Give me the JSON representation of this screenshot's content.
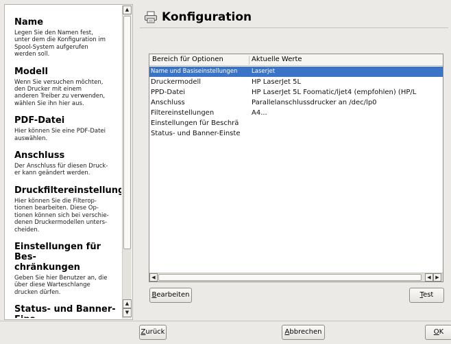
{
  "help": {
    "sections": [
      {
        "heading": "Name",
        "text": "Legen Sie den Namen fest,\nunter dem die Konfiguration im\nSpool-System aufgerufen\nwerden soll."
      },
      {
        "heading": "Modell",
        "text": "Wenn Sie versuchen möchten,\nden Drucker mit einem\nanderen Treiber zu verwenden,\nwählen Sie ihn hier aus."
      },
      {
        "heading": "PDF-Datei",
        "text": "Hier können Sie eine PDF-Datei\nauswählen."
      },
      {
        "heading": "Anschluss",
        "text": "Der Anschluss für diesen Druck-\ner kann geändert werden."
      },
      {
        "heading": "Druckfiltereinstellungen",
        "text": "Hier können Sie die Filterop-\ntionen bearbeiten. Diese Op-\ntionen können sich bei verschie-\ndenen Druckermodellen unters-\ncheiden."
      },
      {
        "heading": "Einstellungen für Bes-\nchränkungen",
        "text": "Geben Sie hier Benutzer an, die\nüber diese Warteschlange\ndrucken dürfen."
      },
      {
        "heading": "Status- und Banner-Eins-",
        "text": ""
      }
    ],
    "scroll_up_icon": "triangle-up",
    "scroll_down_icon": "triangle-down"
  },
  "header": {
    "title": "Konfiguration",
    "icon": "printer-icon"
  },
  "table": {
    "columns": [
      "Bereich für Optionen",
      "Aktuelle Werte"
    ],
    "rows": [
      {
        "area": "Name und Basiseinstellungen",
        "value": "Laserjet",
        "selected": true
      },
      {
        "area": "Druckermodell",
        "value": "HP LaserJet 5L",
        "selected": false
      },
      {
        "area": "PPD-Datei",
        "value": "HP LaserJet 5L Foomatic/ljet4 (empfohlen) (HP/L",
        "selected": false
      },
      {
        "area": "Anschluss",
        "value": "Parallelanschlussdrucker an /dec/lp0",
        "selected": false
      },
      {
        "area": "Filtereinstellungen",
        "value": "A4...",
        "selected": false
      },
      {
        "area": "Einstellungen für Beschrä",
        "value": "",
        "selected": false
      },
      {
        "area": "Status- und Banner-Einste",
        "value": "",
        "selected": false
      }
    ]
  },
  "buttons": {
    "edit": {
      "mnemonic": "B",
      "rest": "earbeiten"
    },
    "test": {
      "mnemonic": "T",
      "rest": "est"
    },
    "back": {
      "mnemonic": "Z",
      "rest": "urück"
    },
    "cancel": {
      "mnemonic": "A",
      "rest": "bbrechen"
    },
    "ok": {
      "mnemonic": "O",
      "rest": "K"
    }
  },
  "colors": {
    "selection": "#3b74c6",
    "background": "#eceae6"
  }
}
